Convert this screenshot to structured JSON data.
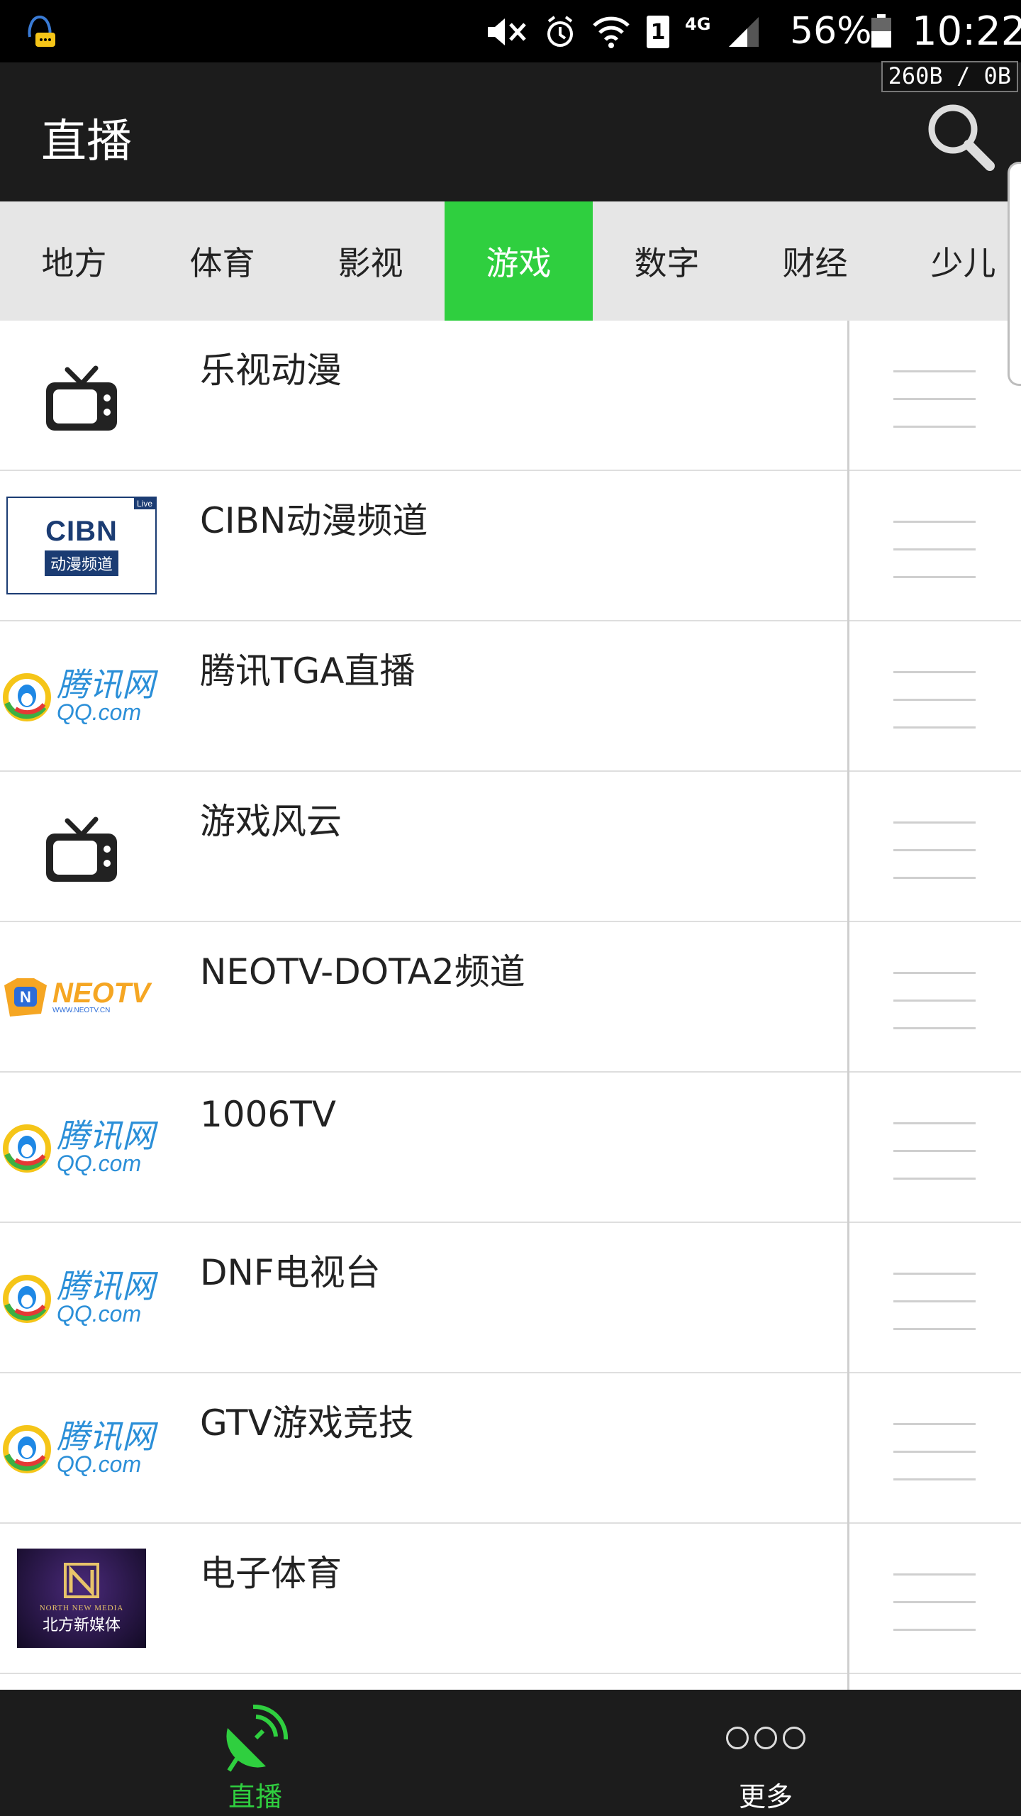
{
  "status_bar": {
    "sim_slot": "1",
    "network": "4G",
    "battery_percent": "56%",
    "time": "10:22",
    "net_speed": "260B / 0B"
  },
  "app_bar": {
    "title": "直播"
  },
  "tabs": [
    {
      "label": "地方",
      "active": false
    },
    {
      "label": "体育",
      "active": false
    },
    {
      "label": "影视",
      "active": false
    },
    {
      "label": "游戏",
      "active": true
    },
    {
      "label": "数字",
      "active": false
    },
    {
      "label": "财经",
      "active": false
    },
    {
      "label": "少儿",
      "active": false
    }
  ],
  "channels": [
    {
      "name": "乐视动漫",
      "logo": "tv-icon"
    },
    {
      "name": "CIBN动漫频道",
      "logo": "cibn-logo",
      "logo_text": "CIBN",
      "logo_subtext": "动漫频道",
      "logo_badge": "Live"
    },
    {
      "name": "腾讯TGA直播",
      "logo": "qq-logo",
      "logo_text": "腾讯网",
      "logo_subtext": "QQ.com"
    },
    {
      "name": "游戏风云",
      "logo": "tv-icon"
    },
    {
      "name": "NEOTV-DOTA2频道",
      "logo": "neotv-logo",
      "logo_text": "NEOTV",
      "logo_subtext": "WWW.NEOTV.CN"
    },
    {
      "name": "1006TV",
      "logo": "qq-logo",
      "logo_text": "腾讯网",
      "logo_subtext": "QQ.com"
    },
    {
      "name": "DNF电视台",
      "logo": "qq-logo",
      "logo_text": "腾讯网",
      "logo_subtext": "QQ.com"
    },
    {
      "name": "GTV游戏竞技",
      "logo": "qq-logo",
      "logo_text": "腾讯网",
      "logo_subtext": "QQ.com"
    },
    {
      "name": "电子体育",
      "logo": "north-media-logo",
      "logo_text": "NORTH NEW MEDIA",
      "logo_subtext": "北方新媒体"
    }
  ],
  "bottom_nav": {
    "live_label": "直播",
    "more_label": "更多"
  },
  "colors": {
    "accent": "#2fcf3f",
    "appbar": "#1c1c1c",
    "tabbar": "#e6e6e6"
  }
}
